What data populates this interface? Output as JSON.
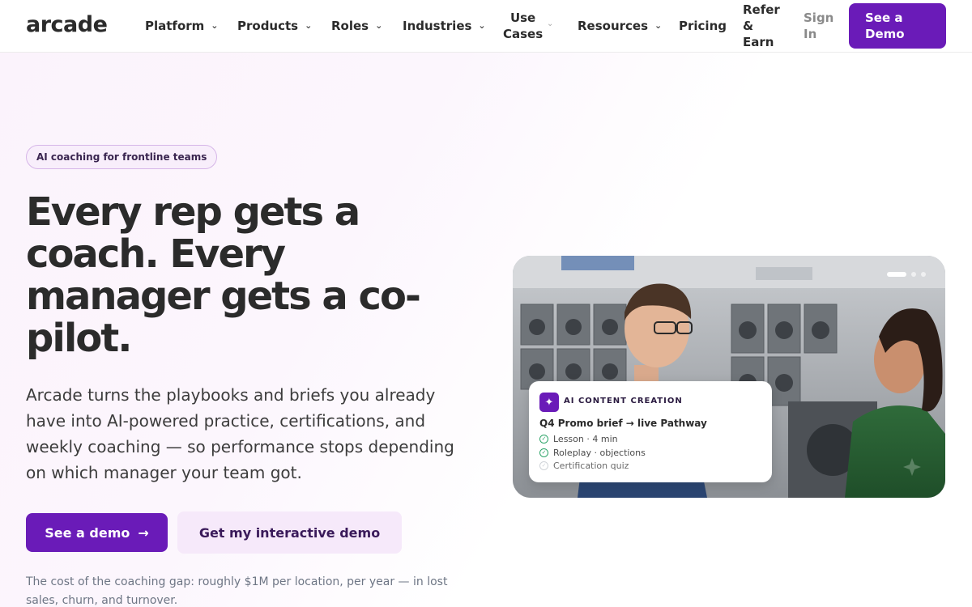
{
  "nav": {
    "logo": "arcade",
    "items": [
      {
        "label": "Platform"
      },
      {
        "label": "Products"
      },
      {
        "label": "Roles"
      },
      {
        "label": "Industries"
      }
    ],
    "use_cases": {
      "line1": "Use",
      "line2": "Cases"
    },
    "resources": "Resources",
    "pricing": "Pricing",
    "refer": {
      "line1": "Refer",
      "line2": "&",
      "line3": "Earn"
    },
    "signin": {
      "line1": "Sign",
      "line2": "In"
    },
    "cta": {
      "line1": "See a",
      "line2": "Demo"
    }
  },
  "hero": {
    "badge": "AI coaching for frontline teams",
    "headline": "Every rep gets a coach. Every manager gets a co-pilot.",
    "subhead": "Arcade turns the playbooks and briefs you already have into AI-powered practice, certifications, and weekly coaching — so performance stops depending on which manager your team got.",
    "primary_button": "See a demo",
    "primary_arrow": "→",
    "secondary_button": "Get my interactive demo",
    "footnote": "The cost of the coaching gap: roughly $1M per location, per year — in lost sales, churn, and turnover."
  },
  "card": {
    "label": "AI CONTENT CREATION",
    "icon": "sparkle-icon",
    "title": "Q4 Promo brief → live Pathway",
    "rows": [
      {
        "text": "Lesson · 4 min",
        "status": "done"
      },
      {
        "text": "Roleplay · objections",
        "status": "done"
      },
      {
        "text": "Certification quiz",
        "status": "pending"
      }
    ]
  },
  "colors": {
    "accent": "#6a1bb8",
    "secondary_bg": "#f6e9fa",
    "check": "#2fa56a"
  }
}
